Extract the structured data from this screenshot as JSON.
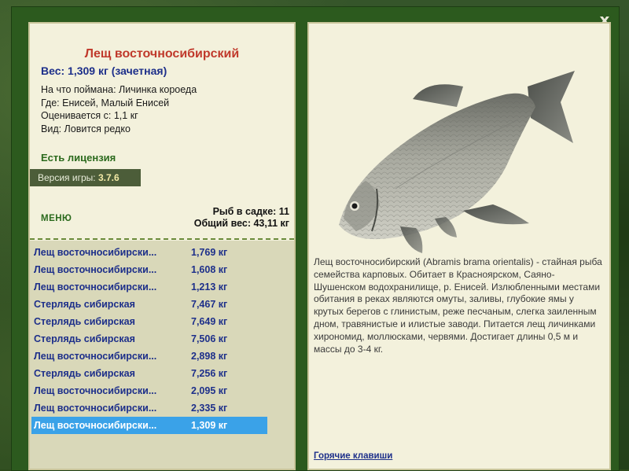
{
  "close_label": "x",
  "fish": {
    "title": "Лещ восточносибирский",
    "weight": "Вес: 1,309 кг (зачетная)",
    "info": [
      "На что поймана: Личинка короеда",
      "Где: Енисей, Малый Енисей",
      "Оценивается с: 1,1 кг",
      "Вид: Ловится редко"
    ],
    "license": "Есть лицензия",
    "description": "Лещ восточносибирский (Abramis brama orientalis) - стайная рыба семейства карповых. Обитает в Красноярском, Саяно-Шушенском водохранилище, р. Енисей. Излюбленными местами обитания в реках являются омуты, заливы, глубокие ямы у крутых берегов с глинистым, реже песчаным, слегка заиленным дном, травянистые и илистые заводи. Питается лещ личинками хирономид, моллюсками, червями. Достигает длины 0,5 м и массы до 3-4 кг."
  },
  "version": {
    "label": "Версия игры: ",
    "value": "3.7.6"
  },
  "menu_label": "МЕНЮ",
  "keepnet": {
    "count": "Рыб в садке: 11",
    "total": "Общий вес: 43,11 кг"
  },
  "catch_list": [
    {
      "name": "Лещ восточносибирски...",
      "weight": "1,769 кг"
    },
    {
      "name": "Лещ восточносибирски...",
      "weight": "1,608 кг"
    },
    {
      "name": "Лещ восточносибирски...",
      "weight": "1,213 кг"
    },
    {
      "name": "Стерлядь сибирская",
      "weight": "7,467 кг"
    },
    {
      "name": "Стерлядь сибирская",
      "weight": "7,649 кг"
    },
    {
      "name": "Стерлядь сибирская",
      "weight": "7,506 кг"
    },
    {
      "name": "Лещ восточносибирски...",
      "weight": "2,898 кг"
    },
    {
      "name": "Стерлядь сибирская",
      "weight": "7,256 кг"
    },
    {
      "name": "Лещ восточносибирски...",
      "weight": "2,095 кг"
    },
    {
      "name": "Лещ восточносибирски...",
      "weight": "2,335 кг"
    },
    {
      "name": "Лещ восточносибирски...",
      "weight": "1,309 кг",
      "selected": true
    }
  ],
  "hotkeys_label": "Горячие клавиши",
  "colors": {
    "title": "#c0392b",
    "accent_blue": "#1d2f8a",
    "selection": "#3aa2e8",
    "license_green": "#2b6a1d"
  }
}
